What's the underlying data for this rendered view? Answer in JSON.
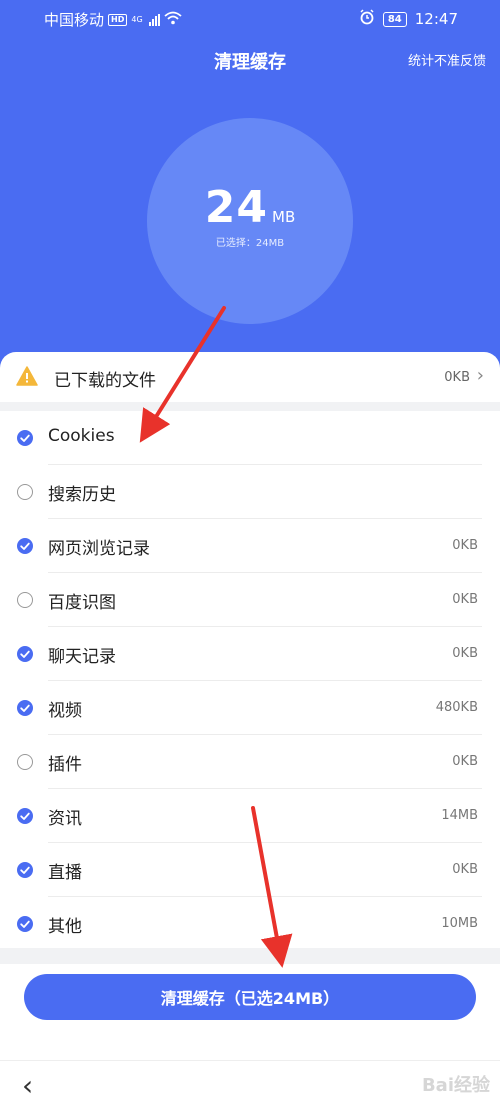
{
  "status_bar": {
    "carrier": "中国移动",
    "hd": "HD",
    "network": "4G",
    "battery": "84",
    "time": "12:47"
  },
  "header": {
    "title": "清理缓存",
    "feedback": "统计不准反馈"
  },
  "summary": {
    "amount": "24",
    "unit": "MB",
    "selected_text": "已选择：24MB"
  },
  "downloaded": {
    "label": "已下载的文件",
    "size": "0KB"
  },
  "items": [
    {
      "label": "Cookies",
      "size": "",
      "checked": true
    },
    {
      "label": "搜索历史",
      "size": "",
      "checked": false
    },
    {
      "label": "网页浏览记录",
      "size": "0KB",
      "checked": true
    },
    {
      "label": "百度识图",
      "size": "0KB",
      "checked": false
    },
    {
      "label": "聊天记录",
      "size": "0KB",
      "checked": true
    },
    {
      "label": "视频",
      "size": "480KB",
      "checked": true
    },
    {
      "label": "插件",
      "size": "0KB",
      "checked": false
    },
    {
      "label": "资讯",
      "size": "14MB",
      "checked": true
    },
    {
      "label": "直播",
      "size": "0KB",
      "checked": true
    },
    {
      "label": "其他",
      "size": "10MB",
      "checked": true
    }
  ],
  "clean_button": {
    "label": "清理缓存（已选24MB）"
  },
  "nav": {
    "back": "‹"
  },
  "watermark": "Bai经验",
  "colors": {
    "primary": "#4a6cf2",
    "circle": "#6688f6",
    "arrow": "#e8322b"
  }
}
